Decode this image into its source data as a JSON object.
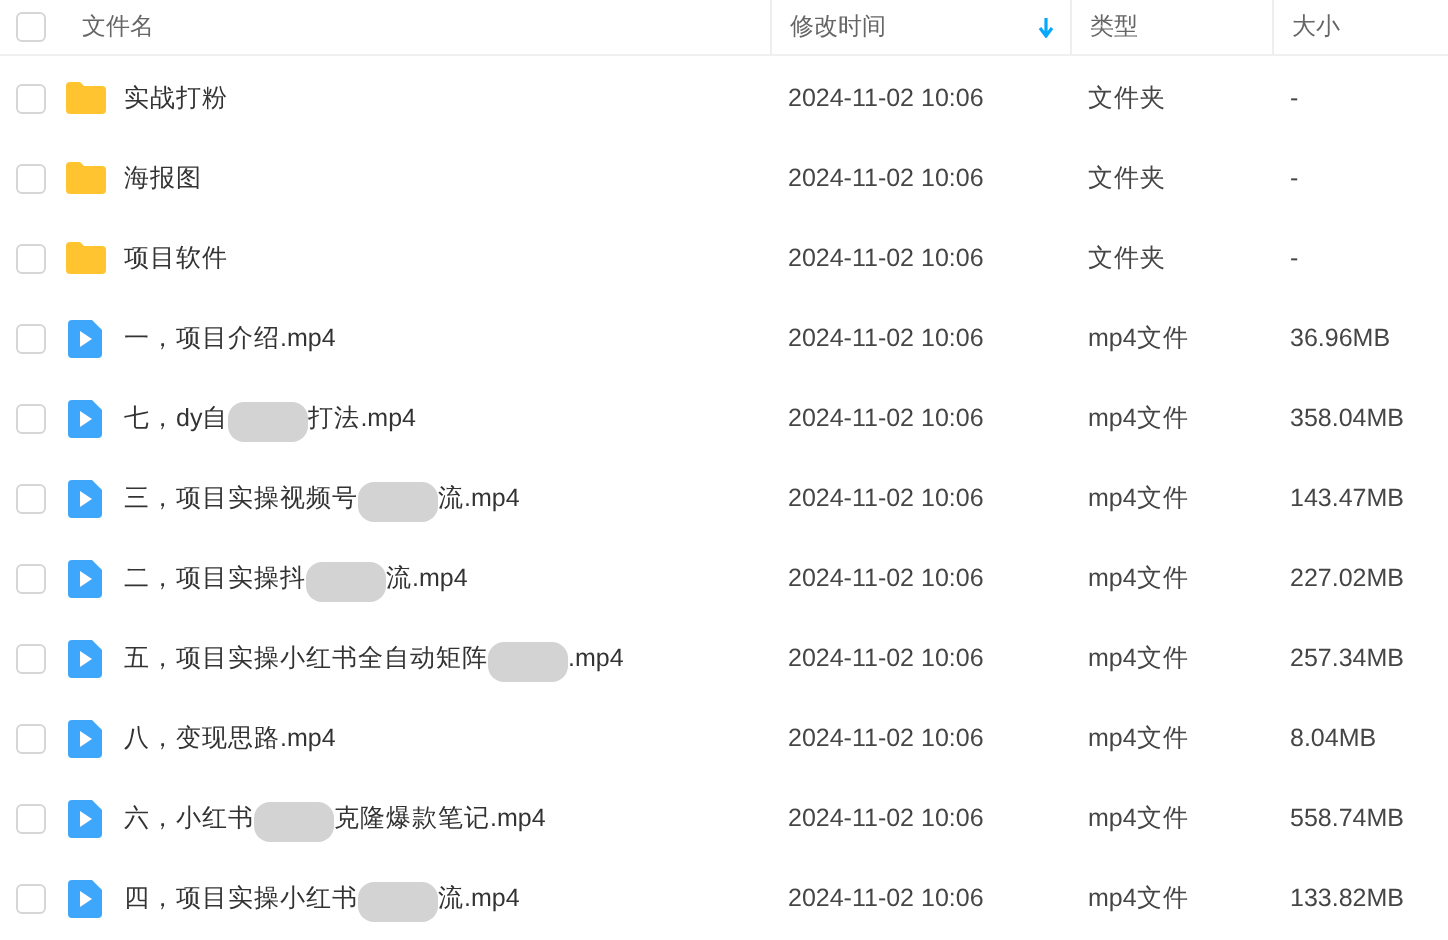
{
  "header": {
    "checked": false,
    "columns": [
      {
        "label": "文件名",
        "sorted": false
      },
      {
        "label": "修改时间",
        "sorted": true
      },
      {
        "label": "类型",
        "sorted": false
      },
      {
        "label": "大小",
        "sorted": false
      }
    ]
  },
  "files": [
    {
      "kind": "folder",
      "checked": false,
      "name": "实战打粉",
      "time": "2024-11-02 10:06",
      "type": "文件夹",
      "size": "-"
    },
    {
      "kind": "folder",
      "checked": false,
      "name": "海报图",
      "time": "2024-11-02 10:06",
      "type": "文件夹",
      "size": "-"
    },
    {
      "kind": "folder",
      "checked": false,
      "name": "项目软件",
      "time": "2024-11-02 10:06",
      "type": "文件夹",
      "size": "-"
    },
    {
      "kind": "video",
      "checked": false,
      "name": "一，项目介绍.mp4",
      "time": "2024-11-02 10:06",
      "type": "mp4文件",
      "size": "36.96MB"
    },
    {
      "kind": "video",
      "checked": false,
      "name": "七，dy自",
      "name_after": "打法.mp4",
      "time": "2024-11-02 10:06",
      "type": "mp4文件",
      "size": "358.04MB"
    },
    {
      "kind": "video",
      "checked": false,
      "name": "三，项目实操视频号",
      "name_after": "流.mp4",
      "time": "2024-11-02 10:06",
      "type": "mp4文件",
      "size": "143.47MB"
    },
    {
      "kind": "video",
      "checked": false,
      "name": "二，项目实操抖",
      "name_after": "流.mp4",
      "time": "2024-11-02 10:06",
      "type": "mp4文件",
      "size": "227.02MB"
    },
    {
      "kind": "video",
      "checked": false,
      "name": "五，项目实操小红书全自动矩阵",
      "name_after": ".mp4",
      "time": "2024-11-02 10:06",
      "type": "mp4文件",
      "size": "257.34MB"
    },
    {
      "kind": "video",
      "checked": false,
      "name": "八，变现思路.mp4",
      "time": "2024-11-02 10:06",
      "type": "mp4文件",
      "size": "8.04MB"
    },
    {
      "kind": "video",
      "checked": false,
      "name": "六，小红书",
      "name_after": "克隆爆款笔记.mp4",
      "time": "2024-11-02 10:06",
      "type": "mp4文件",
      "size": "558.74MB"
    },
    {
      "kind": "video",
      "checked": false,
      "name": "四，项目实操小红书",
      "name_after": "流.mp4",
      "time": "2024-11-02 10:06",
      "type": "mp4文件",
      "size": "133.82MB"
    }
  ]
}
